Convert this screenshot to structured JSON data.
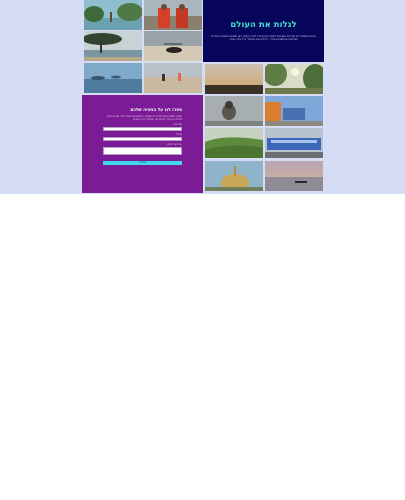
{
  "hero": {
    "title": "לגלות את העולם",
    "subtitle": "אנחנו משפחה של מטיילים שאוהבת לשתף חוויות מכל פינה בעולם. כאן תמצאו תמונות, סיפורים והמלצות מהמסעות שלנו - \"לגלות את העולם\" בכל צעד ושעל."
  },
  "form": {
    "title": "ספרו לנו על החוויה שלכם",
    "description": "נשמח לשמוע מכם! שלחו לנו שאלות, המלצות או סיפורי טיול, ואנחנו נחזור אליכם בהקדם. \"לגלות את העולם\" ביחד איתכם.",
    "name_label": "שם מלא",
    "email_label": "אימייל",
    "message_label": "ההודעה שלכם",
    "submit_label": "שליחה"
  },
  "gallery": {
    "photos": [
      {
        "subject": "lake-trees"
      },
      {
        "subject": "monks-red-robes"
      },
      {
        "subject": "coastal-tree"
      },
      {
        "subject": "beach-dog"
      },
      {
        "subject": "misty-lake"
      },
      {
        "subject": "beach-people"
      },
      {
        "subject": "sunset-plain"
      },
      {
        "subject": "jungle-sun"
      },
      {
        "subject": "monkey"
      },
      {
        "subject": "tuktuk"
      },
      {
        "subject": "tea-hills"
      },
      {
        "subject": "blue-train"
      },
      {
        "subject": "stupa"
      },
      {
        "subject": "sunset-boat"
      }
    ]
  }
}
